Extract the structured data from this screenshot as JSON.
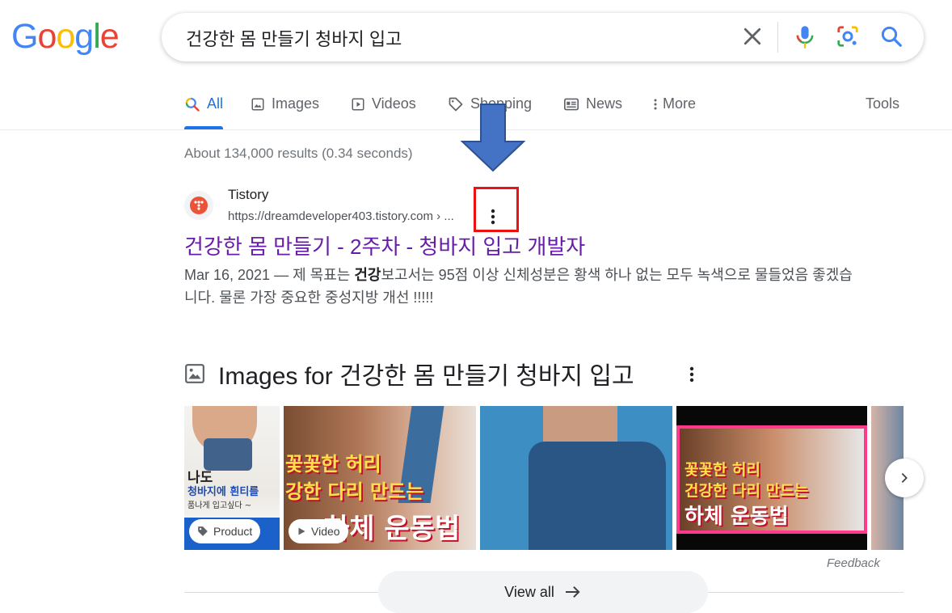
{
  "logo": {
    "letters": [
      "G",
      "o",
      "o",
      "g",
      "l",
      "e"
    ],
    "colors": [
      "#4285f4",
      "#ea4335",
      "#fbbc05",
      "#4285f4",
      "#34a853",
      "#ea4335"
    ]
  },
  "search": {
    "query": "건강한 몸 만들기 청바지 입고"
  },
  "tabs": [
    {
      "label": "All",
      "icon": "search-icon",
      "active": true
    },
    {
      "label": "Images",
      "icon": "image-icon"
    },
    {
      "label": "Videos",
      "icon": "play-icon"
    },
    {
      "label": "Shopping",
      "icon": "tag-icon"
    },
    {
      "label": "News",
      "icon": "news-icon"
    },
    {
      "label": "More",
      "icon": "kebab-icon"
    }
  ],
  "tools_label": "Tools",
  "stats": "About 134,000 results (0.34 seconds)",
  "result": {
    "site_name": "Tistory",
    "url": "https://dreamdeveloper403.tistory.com › ...",
    "title": "건강한 몸 만들기 - 2주차 - 청바지 입고 개발자",
    "snippet_date": "Mar 16, 2021 — 제 목표는 ",
    "snippet_bold": "건강",
    "snippet_rest": "보고서는 95점 이상 신체성분은 황색 하나 없는 모두 녹색으로 물들었음 좋겠습니다. 물론 가장 중요한 중성지방 개선 !!!!!"
  },
  "images_section": {
    "heading_prefix": "Images for ",
    "heading_query": "건강한 몸 만들기 청바지 입고",
    "thumbnails": [
      {
        "chip": "Product",
        "chip_icon": "tag-icon",
        "overlay": [
          "나도",
          "청바지에 흰티를",
          "품나게 입고싶다 ~"
        ]
      },
      {
        "chip": "Video",
        "chip_icon": "play-icon",
        "overlay": [
          "꽃꽃한 허리",
          "강한 다리 만드는",
          "하체 운동법"
        ]
      },
      {
        "chip": "",
        "overlay": []
      },
      {
        "chip": "",
        "overlay": [
          "꽃꽃한 허리",
          "건강한 다리 만드는",
          "하체 운동법"
        ]
      },
      {
        "chip": "",
        "overlay": []
      }
    ],
    "feedback": "Feedback",
    "view_all": "View all"
  },
  "annotation": {
    "arrow_color": "#4472c4",
    "box_color": "#ee1111"
  }
}
